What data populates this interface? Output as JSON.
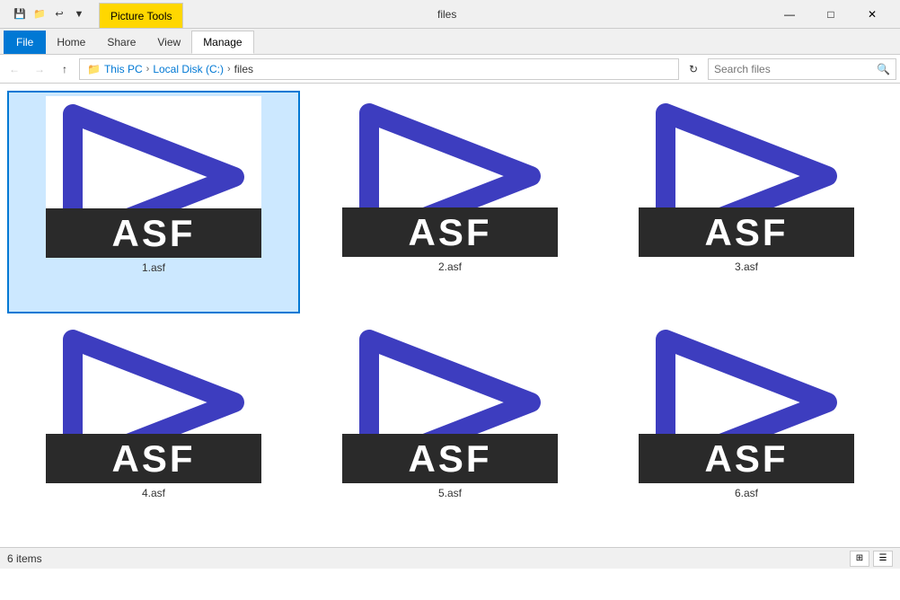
{
  "window": {
    "title": "files",
    "picture_tools_label": "Picture Tools",
    "controls": {
      "minimize": "—",
      "maximize": "□",
      "close": "✕"
    }
  },
  "quick_toolbar": {
    "icons": [
      "💾",
      "📁",
      "↩",
      "▼"
    ]
  },
  "ribbon": {
    "tabs": [
      {
        "label": "File",
        "type": "file"
      },
      {
        "label": "Home",
        "type": "normal"
      },
      {
        "label": "Share",
        "type": "normal"
      },
      {
        "label": "View",
        "type": "normal"
      },
      {
        "label": "Manage",
        "type": "active"
      }
    ]
  },
  "address_bar": {
    "breadcrumbs": [
      "This PC",
      "Local Disk (C:)",
      "files"
    ],
    "search_placeholder": "Search files"
  },
  "files": [
    {
      "name": "1.asf",
      "selected": true
    },
    {
      "name": "2.asf",
      "selected": false
    },
    {
      "name": "3.asf",
      "selected": false
    },
    {
      "name": "4.asf",
      "selected": false
    },
    {
      "name": "5.asf",
      "selected": false
    },
    {
      "name": "6.asf",
      "selected": false
    }
  ],
  "status": {
    "count_label": "6 items"
  }
}
